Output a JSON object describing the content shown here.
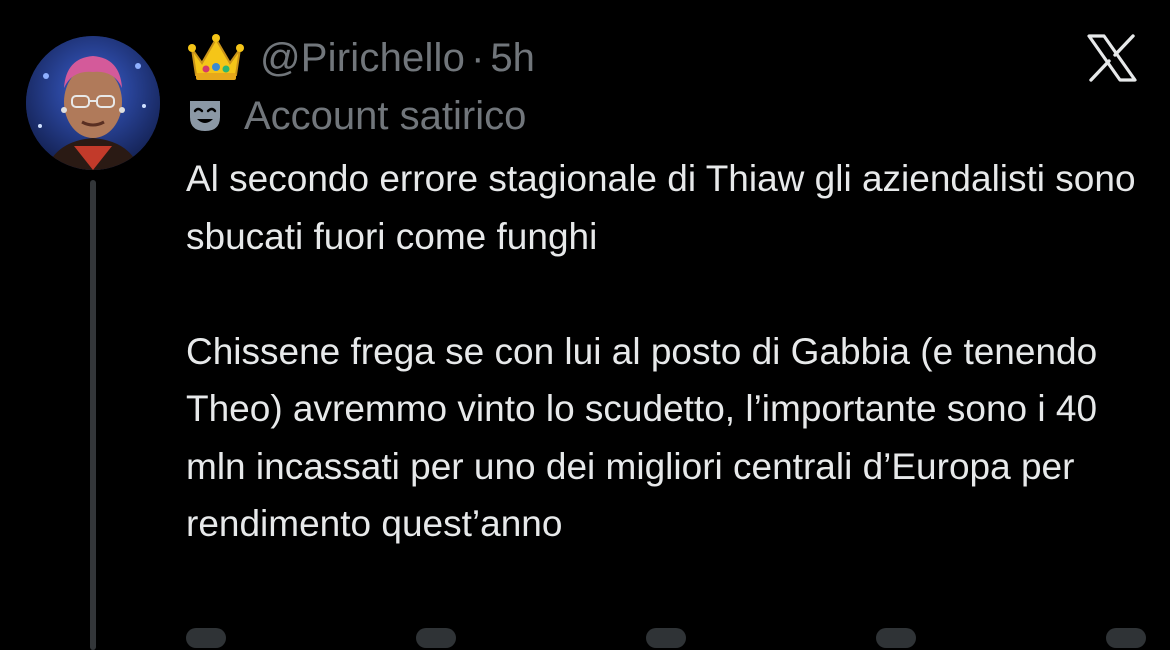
{
  "post": {
    "handle": "@Pirichello",
    "separator": "·",
    "time": "5h",
    "badge_label": "Account satirico",
    "paragraphs": [
      "Al secondo errore stagionale di Thiaw gli aziendalisti sono sbucati fuori come funghi",
      "Chissene frega se con lui al posto di Gabbia (e tenendo Theo) avremmo vinto lo scudetto, l’importante sono i 40 mln incassati per uno dei migliori centrali d’Europa per rendimento quest’anno"
    ]
  },
  "icons": {
    "crown": "crown-emoji-icon",
    "mask": "performing-arts-mask-icon",
    "close": "x-logo-icon"
  },
  "colors": {
    "background": "#000000",
    "primary_text": "#e7e9ea",
    "secondary_text": "#71767b",
    "thread_line": "#333639"
  }
}
